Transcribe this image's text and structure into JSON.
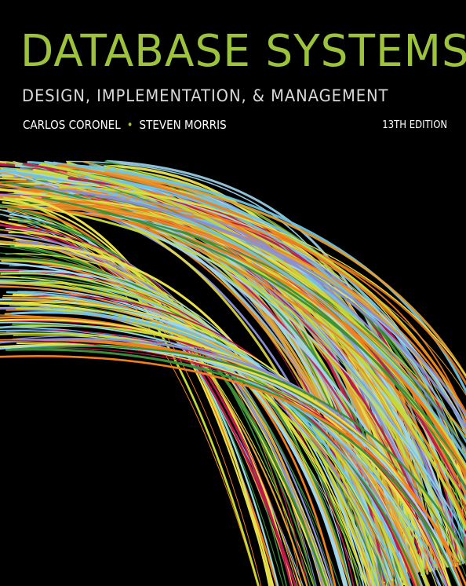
{
  "cover": {
    "title": "DATABASE SYSTEMS",
    "subtitle": "DESIGN, IMPLEMENTATION, & MANAGEMENT",
    "authors": [
      "CARLOS CORONEL",
      "STEVEN MORRIS"
    ],
    "author_separator": "•",
    "edition": "13TH EDITION"
  },
  "colors": {
    "background": "#000000",
    "title": "#9cc33b",
    "subtitle": "#d9d9d9",
    "author_text": "#ffffff",
    "author_dot": "#9cc33b",
    "edition_text": "#ffffff",
    "strands": [
      "#9fd6ee",
      "#c5d937",
      "#e0a23a",
      "#c0174f",
      "#f07f1e",
      "#3b8f3a",
      "#8a8fd6",
      "#e8e04a",
      "#6fc3e5"
    ]
  },
  "artwork": {
    "description_icon": "colored-strand-globe-icon"
  }
}
